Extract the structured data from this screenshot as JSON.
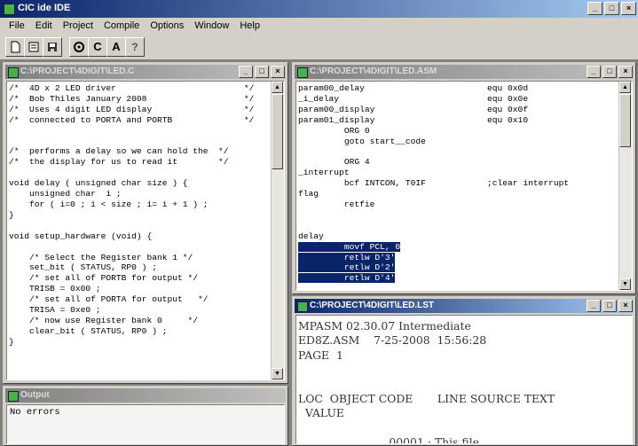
{
  "app": {
    "title": "CIC ide IDE"
  },
  "window_buttons": {
    "min": "_",
    "max": "□",
    "close": "×"
  },
  "menu": [
    "File",
    "Edit",
    "Project",
    "Compile",
    "Options",
    "Window",
    "Help"
  ],
  "toolbar": {
    "buttons": [
      "",
      "",
      "",
      "",
      "C",
      "A",
      "?"
    ]
  },
  "icons": {
    "toolbar": [
      "new-file-icon",
      "open-file-icon",
      "save-icon",
      "settings-icon",
      "compile-c-icon",
      "assemble-a-icon",
      "help-icon"
    ]
  },
  "windows": {
    "source": {
      "title": "C:\\PROJECT\\4DIGIT\\LED.C",
      "code": "/*  4D x 2 LED driver                         */\n/*  Bob Thiles January 2008                   */\n/*  Uses 4 digit LED display                  */\n/*  connected to PORTA and PORTB              */\n\n\n/*  performs a delay so we can hold the  */\n/*  the display for us to read it        */\n\nvoid delay ( unsigned char size ) {\n    unsigned char  i ;\n    for ( i=0 ; i < size ; i= i + 1 ) ;\n}\n\nvoid setup_hardware (void) {\n\n    /* Select the Register bank 1 */\n    set_bit ( STATUS, RP0 ) ;\n    /* set all of PORTB for output */\n    TRISB = 0x00 ;\n    /* set all of PORTA for output   */\n    TRISA = 0xe0 ;\n    /* now use Register bank 0     */\n    clear_bit ( STATUS, RP0 ) ;\n}"
    },
    "asm": {
      "title": "C:\\PROJECT\\4DIGIT\\LED.ASM",
      "code": "param00_delay                        equ 0x0d\n_i_delay                             equ 0x0e\nparam00_display                      equ 0x0f\nparam01_display                      equ 0x10\n         ORG 0\n         goto start__code\n\n         ORG 4\n_interrupt\n         bcf INTCON, T0IF            ;clear interrupt\nflag\n         retfie\n\n\ndelay",
      "selected_lines": [
        "         movf PCL, 0",
        "         retlw D'3'",
        "         retlw D'2'",
        "         retlw D'4'"
      ]
    },
    "listing": {
      "title": "C:\\PROJECT\\4DIGIT\\LED.LST",
      "text": "MPASM 02.30.07 Intermediate\nED8Z.ASM    7-25-2008  15:56:28\nPAGE  1\n\n\nLOC  OBJECT CODE       LINE SOURCE TEXT\n  VALUE\n\n                          00001 ; This file"
    },
    "output": {
      "title": "Output",
      "text": "No errors"
    }
  }
}
